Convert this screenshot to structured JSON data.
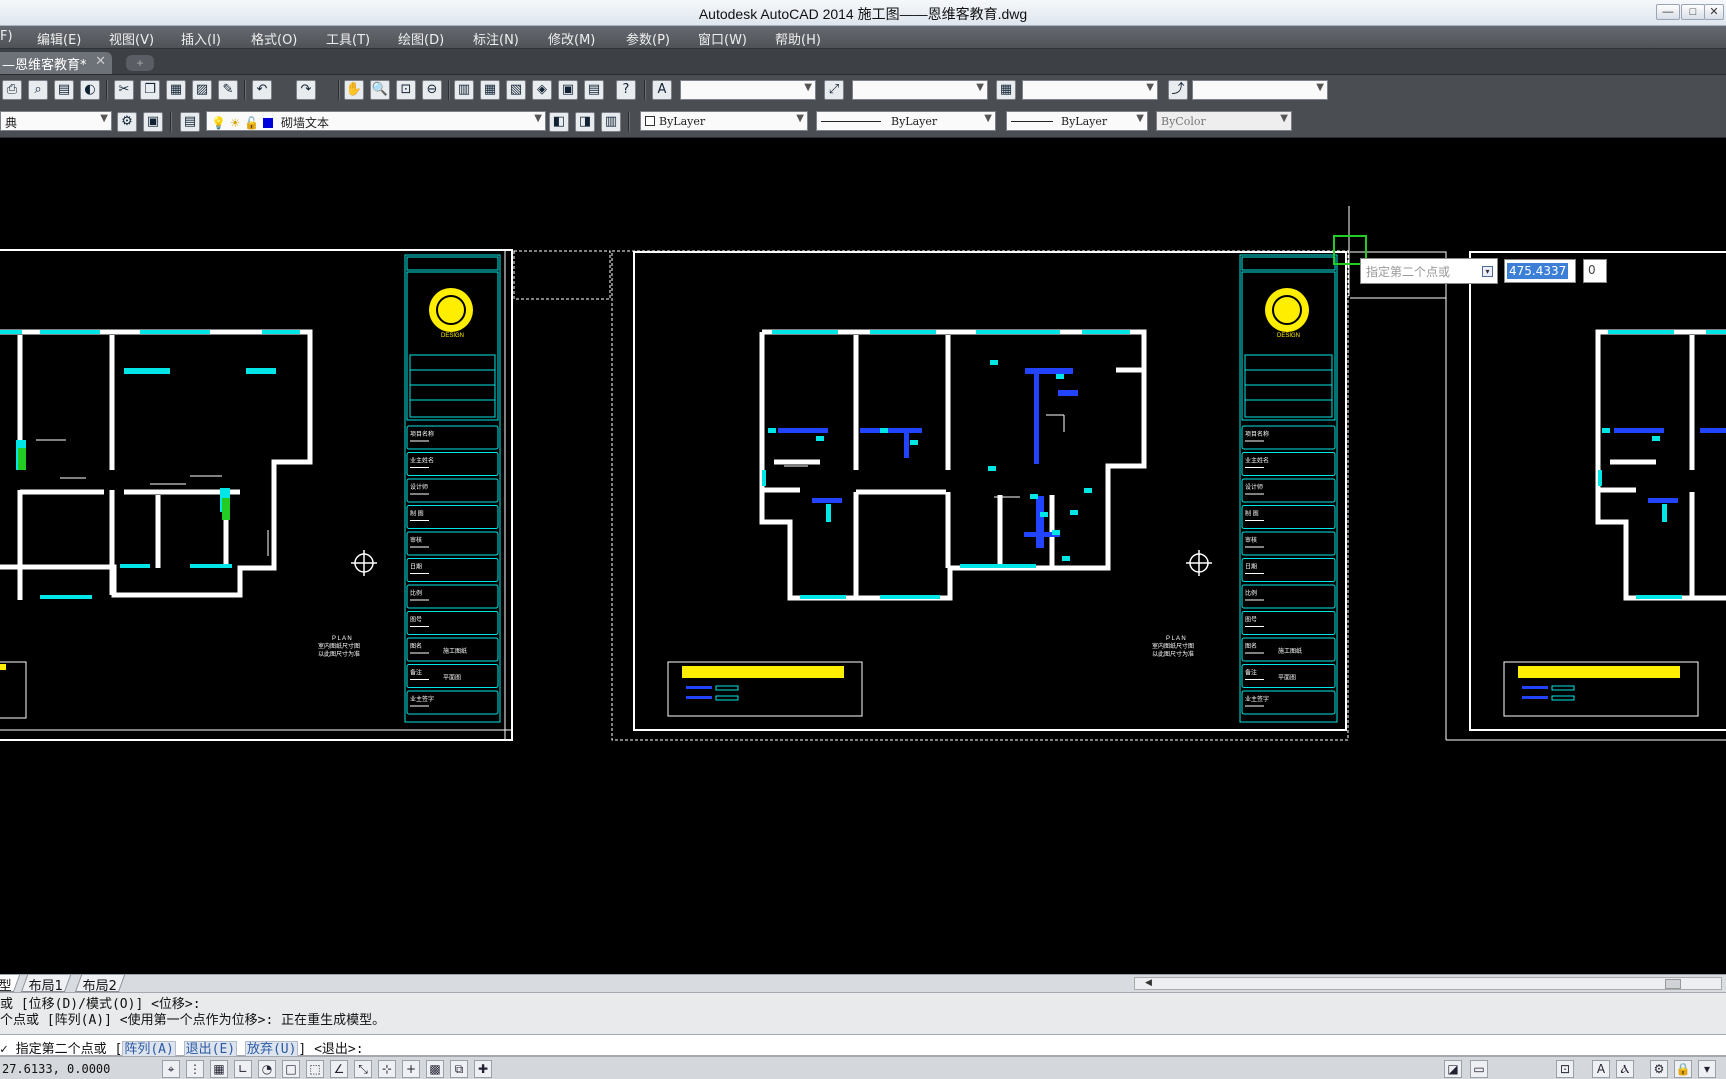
{
  "window": {
    "title": "Autodesk AutoCAD 2014    施工图——恩维客教育.dwg",
    "controls": [
      "—",
      "□",
      "✕"
    ]
  },
  "menu": [
    "F)",
    "编辑(E)",
    "视图(V)",
    "插入(I)",
    "格式(O)",
    "工具(T)",
    "绘图(D)",
    "标注(N)",
    "修改(M)",
    "参数(P)",
    "窗口(W)",
    "帮助(H)"
  ],
  "doc_tab": {
    "label": "—恩维客教育*",
    "close": "✕",
    "new_tab": "+"
  },
  "toolbar1": {
    "combos": [
      "",
      "",
      "",
      ""
    ]
  },
  "toolbar2": {
    "workspace_combo": "典",
    "layer_combo": "砌墙文本",
    "color_combo": "ByLayer",
    "linetype_combo": "ByLayer",
    "lineweight_combo": "ByLayer",
    "plotstyle_combo": "ByColor"
  },
  "drawing": {
    "plan_label": "P L A N",
    "plan_sublabel_1": "室内图纸尺寸图",
    "plan_sublabel_2": "以此图尺寸为准",
    "titleblock_logo_text": "DESIGN",
    "titleblock_rows": [
      "项目名称",
      "业主姓名",
      "设计师",
      "制 图",
      "审核",
      "日期",
      "比例",
      "图号",
      "图名",
      "备注",
      "业主签字"
    ],
    "titleblock_row_value": "施工图纸",
    "titleblock_row_value2": "平面图"
  },
  "dynamic_input": {
    "prompt": "指定第二个点或",
    "distance": "475.4337",
    "angle": "0"
  },
  "layout_tabs": [
    "型",
    "布局1",
    "布局2"
  ],
  "command": {
    "history_1": "或 [位移(D)/模式(O)] <位移>:",
    "history_2": "个点或 [阵列(A)] <使用第一个点作为位移>: 正在重生成模型。",
    "prompt_prefix": "✓ 指定第二个点或 [",
    "opt_array": "阵列(A)",
    "opt_exit": "退出(E)",
    "opt_undo": "放弃(U)",
    "prompt_suffix": "] <退出>:"
  },
  "status": {
    "coords": "27.6133, 0.0000"
  },
  "colors": {
    "wall": "#ffffff",
    "window": "#00e5e5",
    "furniture": "#2244ff",
    "title_bar": "#ffff00",
    "frame": "#ffffff"
  }
}
